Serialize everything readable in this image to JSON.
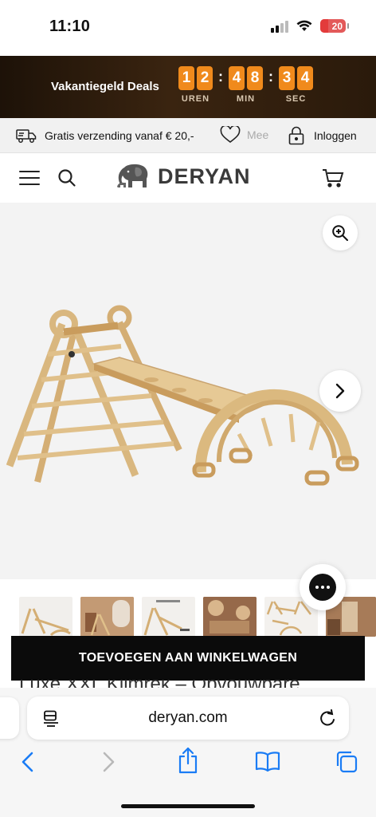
{
  "status_bar": {
    "time": "11:10",
    "battery": "20",
    "battery_color": "#e35a5a"
  },
  "promo": {
    "title": "Vakantiegeld Deals",
    "countdown": {
      "hours": [
        "1",
        "2"
      ],
      "minutes": [
        "4",
        "8"
      ],
      "seconds": [
        "3",
        "4"
      ],
      "separator": ":",
      "hours_label": "UREN",
      "minutes_label": "MIN",
      "seconds_label": "SEC"
    },
    "accent_color": "#f08a1c"
  },
  "usp_bar": {
    "shipping": "Gratis verzending vanaf € 20,-",
    "wishlist": "Mee",
    "login": "Inloggen"
  },
  "header": {
    "logo": "DERYAN",
    "icons": [
      "menu-icon",
      "search-icon",
      "elephant-logo-icon",
      "cart-icon"
    ]
  },
  "gallery": {
    "icons": [
      "zoom-in-icon",
      "chevron-right-icon"
    ]
  },
  "thumbnails": {
    "count": 6
  },
  "chat": {
    "icon": "chat-icon"
  },
  "cta": {
    "add_to_cart": "TOEVOEGEN AAN WINKELWAGEN"
  },
  "product": {
    "title": "Luxe XXL Klimrek – Opvouwbare"
  },
  "browser": {
    "url": "deryan.com",
    "toolbar_icons": [
      "back-icon",
      "forward-icon",
      "share-icon",
      "bookmarks-icon",
      "tabs-icon"
    ]
  }
}
